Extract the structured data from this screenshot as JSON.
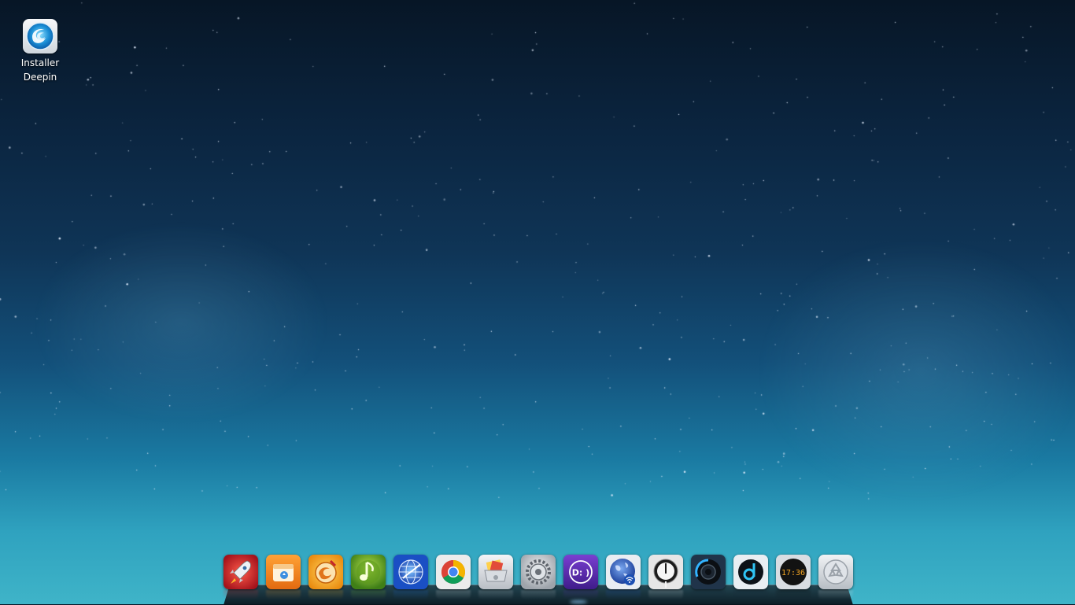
{
  "desktop": {
    "icons": [
      {
        "label": "Installer\nDeepin",
        "icon": "deepin-installer-icon"
      }
    ]
  },
  "dock": {
    "apps": [
      {
        "name": "launcher-icon",
        "color": "#d6282b"
      },
      {
        "name": "file-manager-icon",
        "color": "#f08b1f"
      },
      {
        "name": "deepin-store-icon",
        "color": "#f2a61a"
      },
      {
        "name": "deepin-music-icon",
        "color": "#7ab82a"
      },
      {
        "name": "web-browser-icon",
        "color": "#1f63d0"
      },
      {
        "name": "chrome-icon",
        "color": "#e7e7e7"
      },
      {
        "name": "mail-icon",
        "color": "#cfd3d8"
      },
      {
        "name": "system-settings-icon",
        "color": "#c9ccd0"
      },
      {
        "name": "deepin-feedback-icon",
        "color": "#5a2aa8"
      },
      {
        "name": "network-icon",
        "color": "#2753b5"
      },
      {
        "name": "power-icon",
        "color": "#e8e8e8"
      },
      {
        "name": "media-player-icon",
        "color": "#1d2a38"
      },
      {
        "name": "deepin-movie-icon",
        "color": "#1d2a38"
      },
      {
        "name": "clock-icon",
        "color": "#121212",
        "time": "17:36"
      },
      {
        "name": "trash-icon",
        "color": "#d7dbe0"
      }
    ]
  }
}
